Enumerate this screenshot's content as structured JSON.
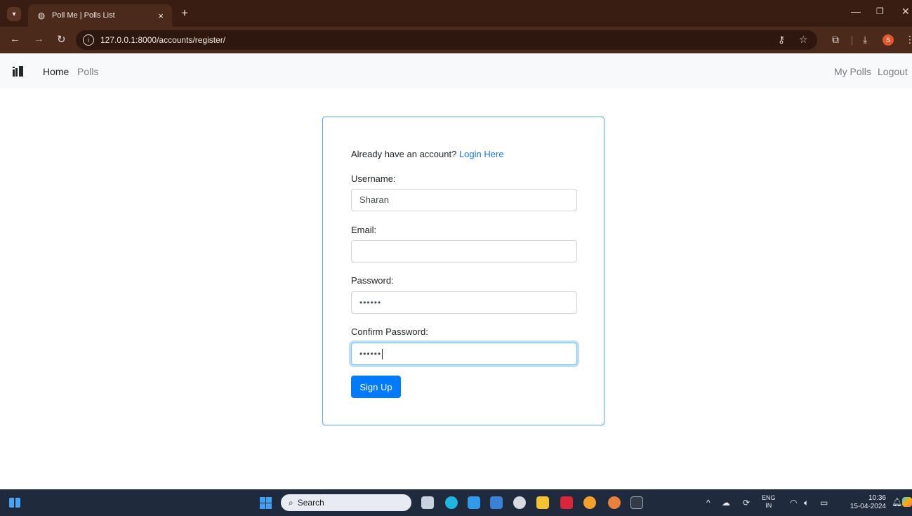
{
  "browser": {
    "tab_title": "Poll Me | Polls List",
    "tab_close": "×",
    "new_tab": "+",
    "url": "127.0.0.1:8000/accounts/register/",
    "profile_initial": "S"
  },
  "navbar": {
    "links": [
      "Home",
      "Polls"
    ],
    "right_links": [
      "My Polls",
      "Logout"
    ]
  },
  "form": {
    "prompt_text": "Already have an account?",
    "login_link": "Login Here",
    "username_label": "Username:",
    "username_value": "Sharan",
    "email_label": "Email:",
    "email_value": "",
    "password_label": "Password:",
    "password_value": "••••••",
    "confirm_label": "Confirm Password:",
    "confirm_value": "••••••",
    "submit_label": "Sign Up"
  },
  "taskbar": {
    "search_label": "Search",
    "lang_top": "ENG",
    "lang_bottom": "IN",
    "time": "10:36",
    "date": "15-04-2024"
  },
  "colors": {
    "primary": "#007bff",
    "card_border": "#5aa4f3",
    "chrome_bg": "#3a1d12"
  }
}
